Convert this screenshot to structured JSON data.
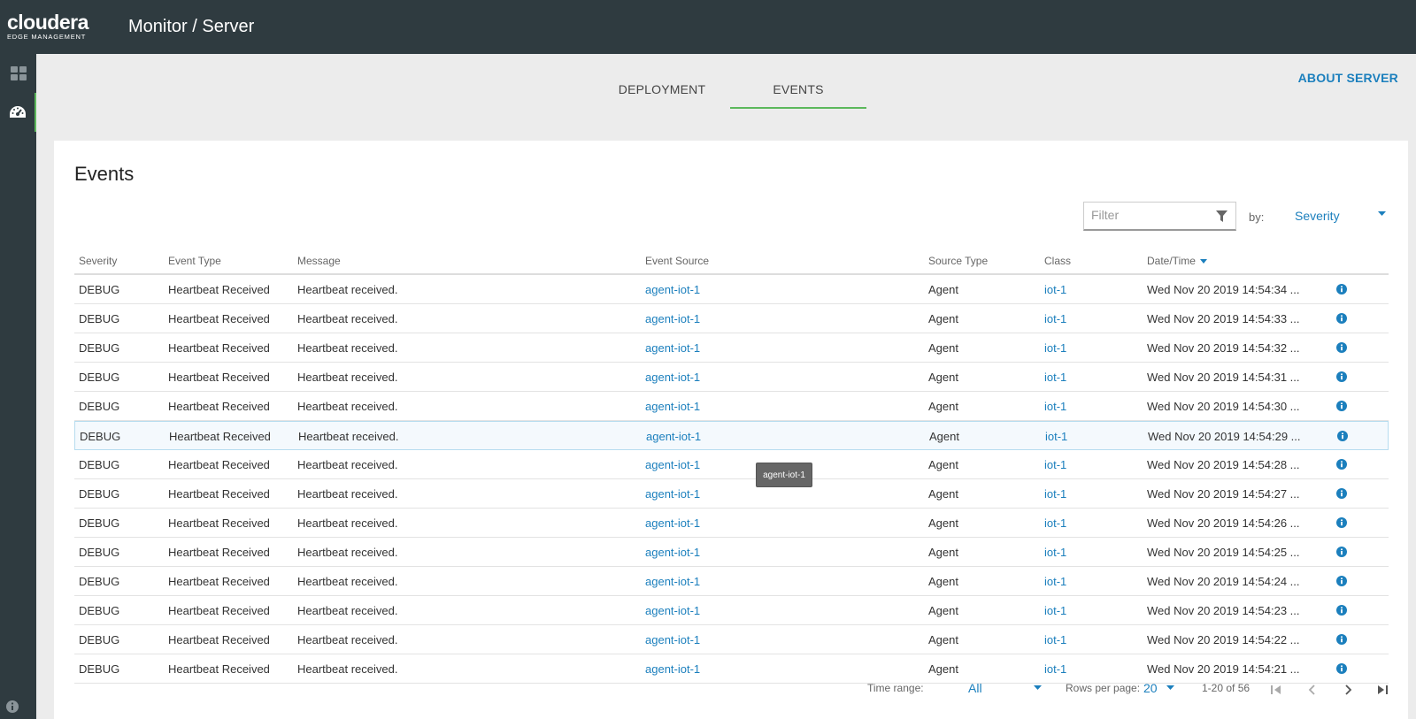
{
  "app": {
    "brand": "cloudera",
    "brand_sub": "EDGE MANAGEMENT",
    "page_title": "Monitor / Server"
  },
  "tabs": [
    {
      "label": "DEPLOYMENT",
      "active": false
    },
    {
      "label": "EVENTS",
      "active": true
    }
  ],
  "about_link": "ABOUT SERVER",
  "events": {
    "title": "Events",
    "filter_placeholder": "Filter",
    "by_label": "by:",
    "by_value": "Severity",
    "columns": [
      "Severity",
      "Event Type",
      "Message",
      "Event Source",
      "Source Type",
      "Class",
      "Date/Time"
    ],
    "rows": [
      [
        "DEBUG",
        "Heartbeat Received",
        "Heartbeat received.",
        "agent-iot-1",
        "Agent",
        "iot-1",
        "Wed Nov 20 2019 14:54:34 ..."
      ],
      [
        "DEBUG",
        "Heartbeat Received",
        "Heartbeat received.",
        "agent-iot-1",
        "Agent",
        "iot-1",
        "Wed Nov 20 2019 14:54:33 ..."
      ],
      [
        "DEBUG",
        "Heartbeat Received",
        "Heartbeat received.",
        "agent-iot-1",
        "Agent",
        "iot-1",
        "Wed Nov 20 2019 14:54:32 ..."
      ],
      [
        "DEBUG",
        "Heartbeat Received",
        "Heartbeat received.",
        "agent-iot-1",
        "Agent",
        "iot-1",
        "Wed Nov 20 2019 14:54:31 ..."
      ],
      [
        "DEBUG",
        "Heartbeat Received",
        "Heartbeat received.",
        "agent-iot-1",
        "Agent",
        "iot-1",
        "Wed Nov 20 2019 14:54:30 ..."
      ],
      [
        "DEBUG",
        "Heartbeat Received",
        "Heartbeat received.",
        "agent-iot-1",
        "Agent",
        "iot-1",
        "Wed Nov 20 2019 14:54:29 ..."
      ],
      [
        "DEBUG",
        "Heartbeat Received",
        "Heartbeat received.",
        "agent-iot-1",
        "Agent",
        "iot-1",
        "Wed Nov 20 2019 14:54:28 ..."
      ],
      [
        "DEBUG",
        "Heartbeat Received",
        "Heartbeat received.",
        "agent-iot-1",
        "Agent",
        "iot-1",
        "Wed Nov 20 2019 14:54:27 ..."
      ],
      [
        "DEBUG",
        "Heartbeat Received",
        "Heartbeat received.",
        "agent-iot-1",
        "Agent",
        "iot-1",
        "Wed Nov 20 2019 14:54:26 ..."
      ],
      [
        "DEBUG",
        "Heartbeat Received",
        "Heartbeat received.",
        "agent-iot-1",
        "Agent",
        "iot-1",
        "Wed Nov 20 2019 14:54:25 ..."
      ],
      [
        "DEBUG",
        "Heartbeat Received",
        "Heartbeat received.",
        "agent-iot-1",
        "Agent",
        "iot-1",
        "Wed Nov 20 2019 14:54:24 ..."
      ],
      [
        "DEBUG",
        "Heartbeat Received",
        "Heartbeat received.",
        "agent-iot-1",
        "Agent",
        "iot-1",
        "Wed Nov 20 2019 14:54:23 ..."
      ],
      [
        "DEBUG",
        "Heartbeat Received",
        "Heartbeat received.",
        "agent-iot-1",
        "Agent",
        "iot-1",
        "Wed Nov 20 2019 14:54:22 ..."
      ],
      [
        "DEBUG",
        "Heartbeat Received",
        "Heartbeat received.",
        "agent-iot-1",
        "Agent",
        "iot-1",
        "Wed Nov 20 2019 14:54:21 ..."
      ]
    ],
    "highlighted_row": 5,
    "tooltip": "agent-iot-1"
  },
  "pagination": {
    "time_range_label": "Time range:",
    "time_range_value": "All",
    "rows_per_page_label": "Rows per page:",
    "rows_per_page_value": "20",
    "count": "1-20 of 56"
  },
  "colors": {
    "topbar": "#2f3b40",
    "accent_green": "#5cb85c",
    "link_blue": "#1b7fbd"
  }
}
